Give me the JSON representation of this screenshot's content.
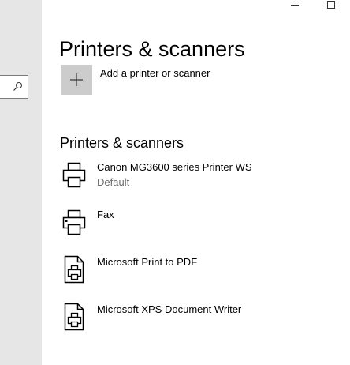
{
  "page": {
    "title": "Printers & scanners"
  },
  "add": {
    "label": "Add a printer or scanner"
  },
  "section": {
    "title": "Printers & scanners"
  },
  "printers": [
    {
      "name": "Canon MG3600 series Printer WS",
      "status": "Default",
      "icon": "printer-icon"
    },
    {
      "name": "Fax",
      "status": "",
      "icon": "fax-printer-icon"
    },
    {
      "name": "Microsoft Print to PDF",
      "status": "",
      "icon": "document-printer-icon"
    },
    {
      "name": "Microsoft XPS Document Writer",
      "status": "",
      "icon": "document-printer-icon"
    }
  ],
  "window": {
    "icons": [
      "minimize-icon",
      "maximize-icon"
    ]
  },
  "sidebar": {
    "search_icon": "search-icon"
  },
  "colors": {
    "sidebar_bg": "#e6e6e6",
    "add_tile_bg": "#cccccc",
    "secondary_text": "#6b6b6b"
  }
}
